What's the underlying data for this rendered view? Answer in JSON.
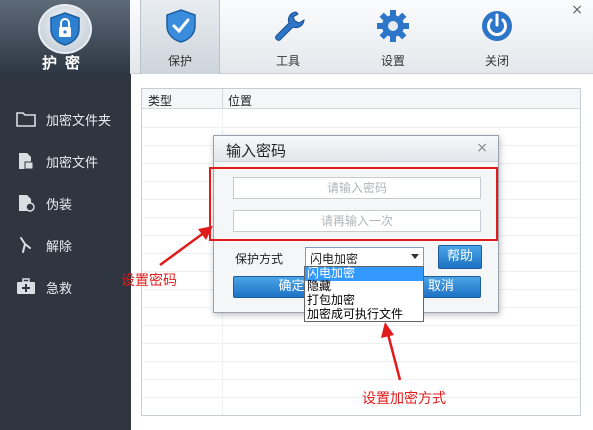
{
  "logo": {
    "label": "护密"
  },
  "window": {
    "close_glyph": "×"
  },
  "toolbar": {
    "buttons": [
      {
        "label": "保护",
        "icon": "shield-icon",
        "active": true
      },
      {
        "label": "工具",
        "icon": "wrench-icon",
        "active": false
      },
      {
        "label": "设置",
        "icon": "gear-icon",
        "active": false
      },
      {
        "label": "关闭",
        "icon": "power-icon",
        "active": false
      }
    ]
  },
  "sidebar": {
    "items": [
      {
        "label": "加密文件夹",
        "icon": "folder-icon"
      },
      {
        "label": "加密文件",
        "icon": "file-icon"
      },
      {
        "label": "伪装",
        "icon": "disguise-icon"
      },
      {
        "label": "解除",
        "icon": "unlock-icon"
      },
      {
        "label": "急救",
        "icon": "first-aid-icon"
      }
    ]
  },
  "table": {
    "columns": [
      "类型",
      "位置"
    ]
  },
  "dialog": {
    "title": "输入密码",
    "close_glyph": "×",
    "password_placeholder": "请输入密码",
    "confirm_placeholder": "请再输入一次",
    "protection_label": "保护方式",
    "protection_value": "闪电加密",
    "help_button": "帮助",
    "ok_button": "确定",
    "cancel_button": "取消",
    "options": [
      "闪电加密",
      "隐藏",
      "打包加密",
      "加密成可执行文件"
    ]
  },
  "annotations": {
    "password": "设置密码",
    "method": "设置加密方式",
    "color": "#e01b1b"
  },
  "colors": {
    "sidebar_bg": "#2f3640",
    "accent_blue": "#1d72c4",
    "highlight": "#3399ff"
  }
}
